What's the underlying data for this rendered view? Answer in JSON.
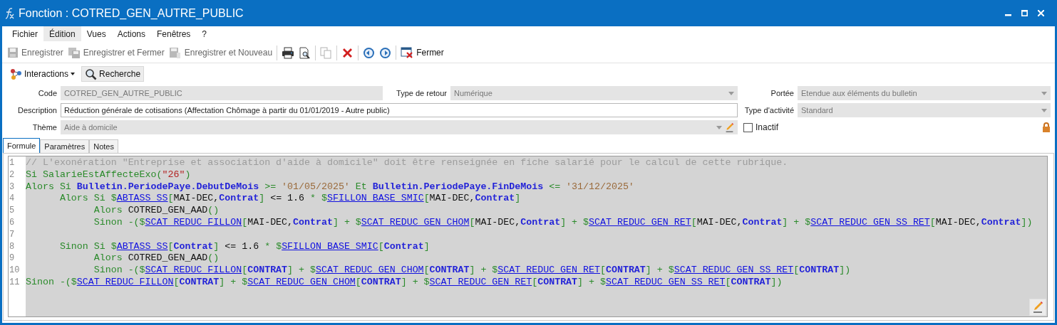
{
  "window": {
    "title": "Fonction : COTRED_GEN_AUTRE_PUBLIC"
  },
  "menu": [
    {
      "label": "Fichier",
      "selected": false
    },
    {
      "label": "Édition",
      "selected": true
    },
    {
      "label": "Vues",
      "selected": false
    },
    {
      "label": "Actions",
      "selected": false
    },
    {
      "label": "Fenêtres",
      "selected": false
    },
    {
      "label": "?",
      "selected": false
    }
  ],
  "toolbar": [
    {
      "buttons": [
        {
          "kind": "save",
          "label": "Enregistrer",
          "disabled": true
        },
        {
          "kind": "save_close",
          "label": "Enregistrer et Fermer",
          "disabled": true
        },
        {
          "kind": "save_new",
          "label": "Enregistrer et Nouveau",
          "disabled": true
        }
      ]
    },
    {
      "buttons": [
        {
          "kind": "print",
          "disabled": false
        },
        {
          "kind": "preview",
          "disabled": false
        }
      ]
    },
    {
      "buttons": [
        {
          "kind": "copy",
          "disabled": true
        }
      ]
    },
    {
      "buttons": [
        {
          "kind": "delete",
          "disabled": false
        }
      ]
    },
    {
      "buttons": [
        {
          "kind": "previous",
          "disabled": false
        },
        {
          "kind": "next",
          "disabled": false
        }
      ]
    },
    {
      "buttons": [
        {
          "kind": "close",
          "label": "Fermer",
          "disabled": false
        }
      ]
    }
  ],
  "actions": [
    {
      "kind": "interactions",
      "label": "Interactions",
      "selected": false
    },
    {
      "kind": "search",
      "label": "Recherche",
      "selected": true
    }
  ],
  "form": {
    "code": {
      "label": "Code",
      "value": "COTRED_GEN_AUTRE_PUBLIC",
      "readonly": true
    },
    "return_type": {
      "label": "Type de retour",
      "value": "Numérique",
      "readonly": true
    },
    "scope": {
      "label": "Portée",
      "value": "Etendue aux éléments du bulletin",
      "readonly": true
    },
    "description": {
      "label": "Description",
      "value": "Réduction générale de cotisations (Affectation Chômage à partir du 01/01/2019 - Autre public)",
      "readonly": false
    },
    "activity_type": {
      "label": "Type d'activité",
      "value": "Standard",
      "readonly": true
    },
    "theme": {
      "label": "Thème",
      "value": "Aide à domicile",
      "readonly": true
    },
    "inactive": {
      "label": "Inactif",
      "checked": false
    },
    "locked": true
  },
  "tabs": [
    {
      "label": "Formule",
      "selected": true
    },
    {
      "label": "Paramètres",
      "selected": false
    },
    {
      "label": "Notes",
      "selected": false
    }
  ],
  "code_lines": [
    {
      "number": "1",
      "tokens": [
        {
          "kind": "cmt",
          "text": "// L'exonération \"Entreprise et association d'aide à domicile\" doit être renseignée en fiche salarié pour le calcul de cette rubrique."
        }
      ]
    },
    {
      "number": "2",
      "tokens": [
        {
          "kind": "kw",
          "text": "Si SalarieEstAffecteExo("
        },
        {
          "kind": "str",
          "text": "\"26\""
        },
        {
          "kind": "kw",
          "text": ")"
        }
      ]
    },
    {
      "number": "3",
      "tokens": [
        {
          "kind": "kw",
          "text": "Alors Si "
        },
        {
          "kind": "id",
          "text": "Bulletin.PeriodePaye.DebutDeMois"
        },
        {
          "kind": "kw",
          "text": " >= "
        },
        {
          "kind": "date",
          "text": "'01/05/2025'"
        },
        {
          "kind": "kw",
          "text": " Et "
        },
        {
          "kind": "id",
          "text": "Bulletin.PeriodePaye.FinDeMois"
        },
        {
          "kind": "kw",
          "text": " <= "
        },
        {
          "kind": "date",
          "text": "'31/12/2025'"
        }
      ]
    },
    {
      "number": "4",
      "tokens": [
        {
          "kind": "kw",
          "text": "      Alors Si $"
        },
        {
          "kind": "ref",
          "text": "ABTASS_SS"
        },
        {
          "kind": "kw",
          "text": "["
        },
        {
          "kind": "plain",
          "text": "MAI-DEC,"
        },
        {
          "kind": "id",
          "text": "Contrat"
        },
        {
          "kind": "kw",
          "text": "] "
        },
        {
          "kind": "plain",
          "text": "<= 1.6 "
        },
        {
          "kind": "kw",
          "text": "* $"
        },
        {
          "kind": "ref",
          "text": "SFILLON_BASE_SMIC"
        },
        {
          "kind": "kw",
          "text": "["
        },
        {
          "kind": "plain",
          "text": "MAI-DEC,"
        },
        {
          "kind": "id",
          "text": "Contrat"
        },
        {
          "kind": "kw",
          "text": "]"
        }
      ]
    },
    {
      "number": "5",
      "tokens": [
        {
          "kind": "kw",
          "text": "            Alors "
        },
        {
          "kind": "plain",
          "text": "COTRED_GEN_AAD"
        },
        {
          "kind": "kw",
          "text": "()"
        }
      ]
    },
    {
      "number": "6",
      "tokens": [
        {
          "kind": "kw",
          "text": "            Sinon -($"
        },
        {
          "kind": "ref",
          "text": "SCAT_REDUC_FILLON"
        },
        {
          "kind": "kw",
          "text": "["
        },
        {
          "kind": "plain",
          "text": "MAI-DEC,"
        },
        {
          "kind": "id",
          "text": "Contrat"
        },
        {
          "kind": "kw",
          "text": "] + $"
        },
        {
          "kind": "ref",
          "text": "SCAT_REDUC_GEN_CHOM"
        },
        {
          "kind": "kw",
          "text": "["
        },
        {
          "kind": "plain",
          "text": "MAI-DEC,"
        },
        {
          "kind": "id",
          "text": "Contrat"
        },
        {
          "kind": "kw",
          "text": "] + $"
        },
        {
          "kind": "ref",
          "text": "SCAT_REDUC_GEN_RET"
        },
        {
          "kind": "kw",
          "text": "["
        },
        {
          "kind": "plain",
          "text": "MAI-DEC,"
        },
        {
          "kind": "id",
          "text": "Contrat"
        },
        {
          "kind": "kw",
          "text": "] + $"
        },
        {
          "kind": "ref",
          "text": "SCAT_REDUC_GEN_SS_RET"
        },
        {
          "kind": "kw",
          "text": "["
        },
        {
          "kind": "plain",
          "text": "MAI-DEC,"
        },
        {
          "kind": "id",
          "text": "Contrat"
        },
        {
          "kind": "kw",
          "text": "])"
        }
      ]
    },
    {
      "number": "7"
    },
    {
      "number": "8",
      "tokens": [
        {
          "kind": "kw",
          "text": "      Sinon Si $"
        },
        {
          "kind": "ref",
          "text": "ABTASS_SS"
        },
        {
          "kind": "kw",
          "text": "["
        },
        {
          "kind": "id",
          "text": "Contrat"
        },
        {
          "kind": "kw",
          "text": "] "
        },
        {
          "kind": "plain",
          "text": "<= 1.6 "
        },
        {
          "kind": "kw",
          "text": "* $"
        },
        {
          "kind": "ref",
          "text": "SFILLON_BASE_SMIC"
        },
        {
          "kind": "kw",
          "text": "["
        },
        {
          "kind": "id",
          "text": "Contrat"
        },
        {
          "kind": "kw",
          "text": "]"
        }
      ]
    },
    {
      "number": "9",
      "tokens": [
        {
          "kind": "kw",
          "text": "            Alors "
        },
        {
          "kind": "plain",
          "text": "COTRED_GEN_AAD"
        },
        {
          "kind": "kw",
          "text": "()"
        }
      ]
    },
    {
      "number": "10",
      "tokens": [
        {
          "kind": "kw",
          "text": "            Sinon -($"
        },
        {
          "kind": "ref",
          "text": "SCAT_REDUC_FILLON"
        },
        {
          "kind": "kw",
          "text": "["
        },
        {
          "kind": "id",
          "text": "CONTRAT"
        },
        {
          "kind": "kw",
          "text": "] + $"
        },
        {
          "kind": "ref",
          "text": "SCAT_REDUC_GEN_CHOM"
        },
        {
          "kind": "kw",
          "text": "["
        },
        {
          "kind": "id",
          "text": "CONTRAT"
        },
        {
          "kind": "kw",
          "text": "] + $"
        },
        {
          "kind": "ref",
          "text": "SCAT_REDUC_GEN_RET"
        },
        {
          "kind": "kw",
          "text": "["
        },
        {
          "kind": "id",
          "text": "CONTRAT"
        },
        {
          "kind": "kw",
          "text": "] + $"
        },
        {
          "kind": "ref",
          "text": "SCAT_REDUC_GEN_SS_RET"
        },
        {
          "kind": "kw",
          "text": "["
        },
        {
          "kind": "id",
          "text": "CONTRAT"
        },
        {
          "kind": "kw",
          "text": "])"
        }
      ]
    },
    {
      "number": "11",
      "tokens": [
        {
          "kind": "kw",
          "text": "Sinon -($"
        },
        {
          "kind": "ref",
          "text": "SCAT_REDUC_FILLON"
        },
        {
          "kind": "kw",
          "text": "["
        },
        {
          "kind": "id",
          "text": "CONTRAT"
        },
        {
          "kind": "kw",
          "text": "] + $"
        },
        {
          "kind": "ref",
          "text": "SCAT_REDUC_GEN_CHOM"
        },
        {
          "kind": "kw",
          "text": "["
        },
        {
          "kind": "id",
          "text": "CONTRAT"
        },
        {
          "kind": "kw",
          "text": "] + $"
        },
        {
          "kind": "ref",
          "text": "SCAT_REDUC_GEN_RET"
        },
        {
          "kind": "kw",
          "text": "["
        },
        {
          "kind": "id",
          "text": "CONTRAT"
        },
        {
          "kind": "kw",
          "text": "] + $"
        },
        {
          "kind": "ref",
          "text": "SCAT_REDUC_GEN_SS_RET"
        },
        {
          "kind": "kw",
          "text": "["
        },
        {
          "kind": "id",
          "text": "CONTRAT"
        },
        {
          "kind": "kw",
          "text": "])"
        }
      ]
    }
  ]
}
